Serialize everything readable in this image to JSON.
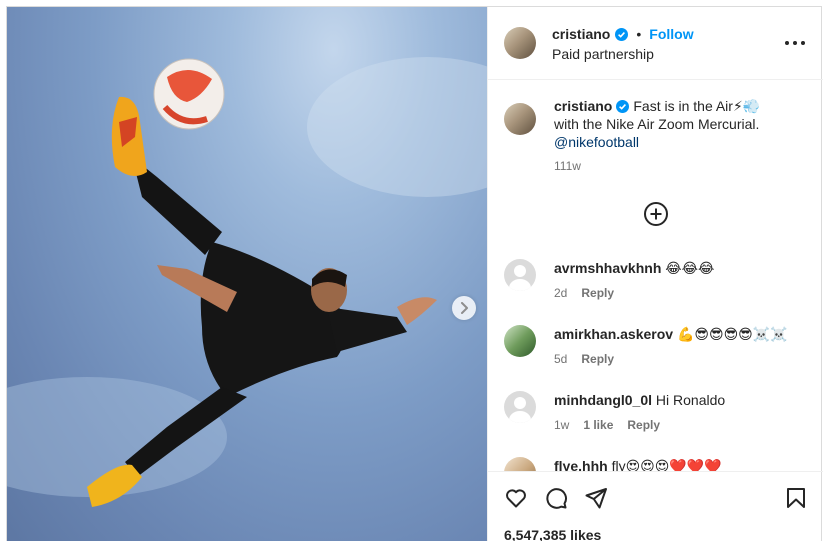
{
  "header": {
    "username": "cristiano",
    "follow_label": "Follow",
    "subtitle": "Paid partnership",
    "icons": {
      "verified": "verified-badge-icon",
      "more": "more-options-icon"
    }
  },
  "media": {
    "next_icon": "chevron-right-icon"
  },
  "caption": {
    "username": "cristiano",
    "text_1": "Fast is in the Air⚡💨",
    "text_2": "with the Nike Air Zoom Mercurial.",
    "mention": "@nikefootball",
    "time": "111w"
  },
  "load_more_icon": "plus-circle-icon",
  "comments": [
    {
      "username": "avrmshhavkhnh",
      "text": "😂😂😂",
      "time": "2d",
      "likes": "",
      "reply": "Reply"
    },
    {
      "username": "amirkhan.askerov",
      "text": "💪😎😎😎😎☠️☠️",
      "time": "5d",
      "likes": "",
      "reply": "Reply"
    },
    {
      "username": "minhdangl0_0l",
      "text": "Hi Ronaldo",
      "time": "1w",
      "likes": "1 like",
      "reply": "Reply"
    },
    {
      "username": "flye.hhh",
      "text": "fly😍😍😍❤️❤️❤️",
      "time": "",
      "likes": "",
      "reply": ""
    }
  ],
  "actions": {
    "icons": [
      "heart-icon",
      "comment-icon",
      "share-icon",
      "bookmark-icon"
    ],
    "likes_count": "6,547,385 likes"
  },
  "colors": {
    "accent": "#0095f6",
    "verified": "#0095f6",
    "text": "#262626",
    "secondary": "#737373",
    "border": "#efefef"
  }
}
